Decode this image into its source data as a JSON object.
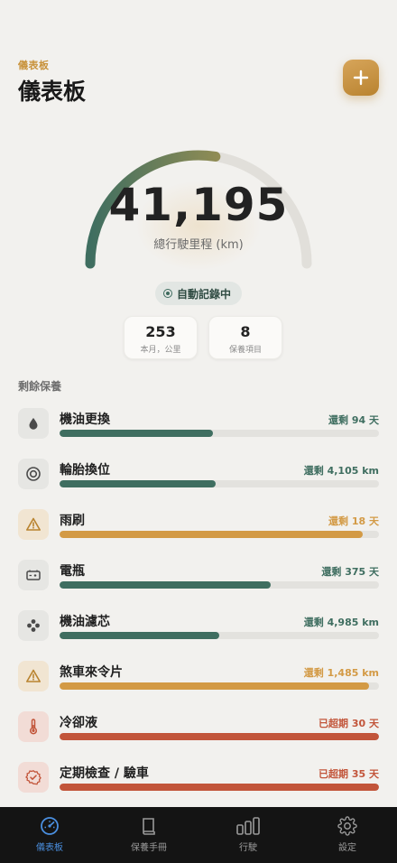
{
  "header": {
    "eyebrow": "儀表板",
    "title": "儀表板",
    "add_icon": "plus-icon"
  },
  "odometer": {
    "value": "41,195",
    "label": "總行駛里程 (km)",
    "progress": 0.55
  },
  "recording": {
    "label": "自動記錄中"
  },
  "stats": [
    {
      "value": "253",
      "label": "本月，公里"
    },
    {
      "value": "8",
      "label": "保養項目"
    }
  ],
  "section_title": "剩餘保養",
  "colors": {
    "green": "#3f6e60",
    "orange": "#d39a45",
    "red": "#c2553a",
    "accent": "#c8923a",
    "tab_active": "#4a8fe0"
  },
  "maintenance": [
    {
      "name": "機油更換",
      "remaining": "還剩 94 天",
      "status": "green",
      "progress": 0.48,
      "icon": "droplet-icon"
    },
    {
      "name": "輪胎換位",
      "remaining": "還剩 4,105 km",
      "status": "green",
      "progress": 0.49,
      "icon": "tire-icon"
    },
    {
      "name": "雨刷",
      "remaining": "還剩 18 天",
      "status": "orange",
      "progress": 0.95,
      "icon": "warning-icon"
    },
    {
      "name": "電瓶",
      "remaining": "還剩 375 天",
      "status": "green",
      "progress": 0.66,
      "icon": "battery-icon"
    },
    {
      "name": "機油濾芯",
      "remaining": "還剩 4,985 km",
      "status": "green",
      "progress": 0.5,
      "icon": "filter-icon"
    },
    {
      "name": "煞車來令片",
      "remaining": "還剩 1,485 km",
      "status": "orange",
      "progress": 0.97,
      "icon": "warning-icon"
    },
    {
      "name": "冷卻液",
      "remaining": "已超期 30 天",
      "status": "red",
      "progress": 1.0,
      "icon": "thermometer-icon"
    },
    {
      "name": "定期檢查 / 驗車",
      "remaining": "已超期 35 天",
      "status": "red",
      "progress": 1.0,
      "icon": "badge-check-icon"
    }
  ],
  "tabs": [
    {
      "label": "儀表板",
      "icon": "speedometer-icon",
      "active": true
    },
    {
      "label": "保養手冊",
      "icon": "book-icon",
      "active": false
    },
    {
      "label": "行駛",
      "icon": "bar-chart-icon",
      "active": false
    },
    {
      "label": "設定",
      "icon": "gear-icon",
      "active": false
    }
  ]
}
